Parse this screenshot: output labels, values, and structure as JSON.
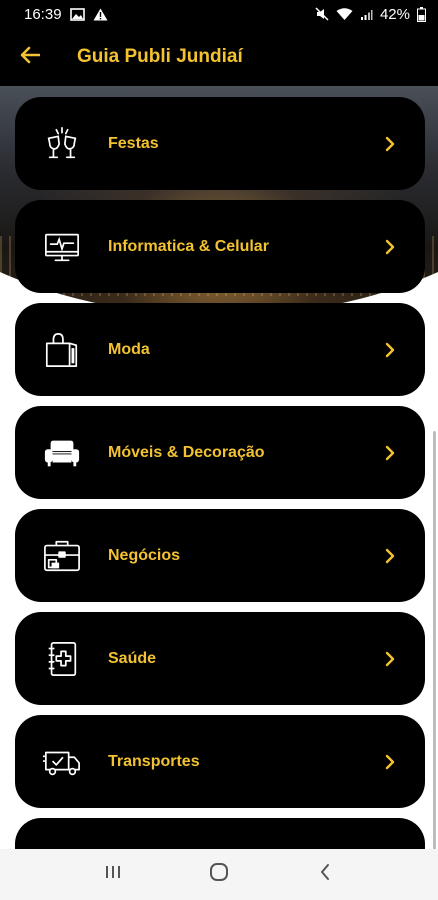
{
  "status_bar": {
    "time": "16:39",
    "battery_percent": "42%",
    "icons": [
      "image-icon",
      "warning-icon",
      "mute-icon",
      "wifi-icon",
      "signal-icon",
      "battery-icon"
    ]
  },
  "app_bar": {
    "title": "Guia Publi Jundiaí",
    "back_icon": "arrow-left-icon"
  },
  "colors": {
    "accent": "#f2c230",
    "card_bg": "#000000",
    "bar_bg": "#000000"
  },
  "categories": [
    {
      "label": "Festas",
      "icon": "champagne-glasses-icon"
    },
    {
      "label": "Informatica & Celular",
      "icon": "computer-monitor-icon"
    },
    {
      "label": "Moda",
      "icon": "shopping-bag-icon"
    },
    {
      "label": "Móveis & Decoração",
      "icon": "sofa-icon"
    },
    {
      "label": "Negócios",
      "icon": "briefcase-icon"
    },
    {
      "label": "Saúde",
      "icon": "medical-book-icon"
    },
    {
      "label": "Transportes",
      "icon": "delivery-truck-icon"
    }
  ],
  "nav_bar": {
    "icons": [
      "recent-apps-icon",
      "home-icon",
      "back-icon"
    ]
  }
}
